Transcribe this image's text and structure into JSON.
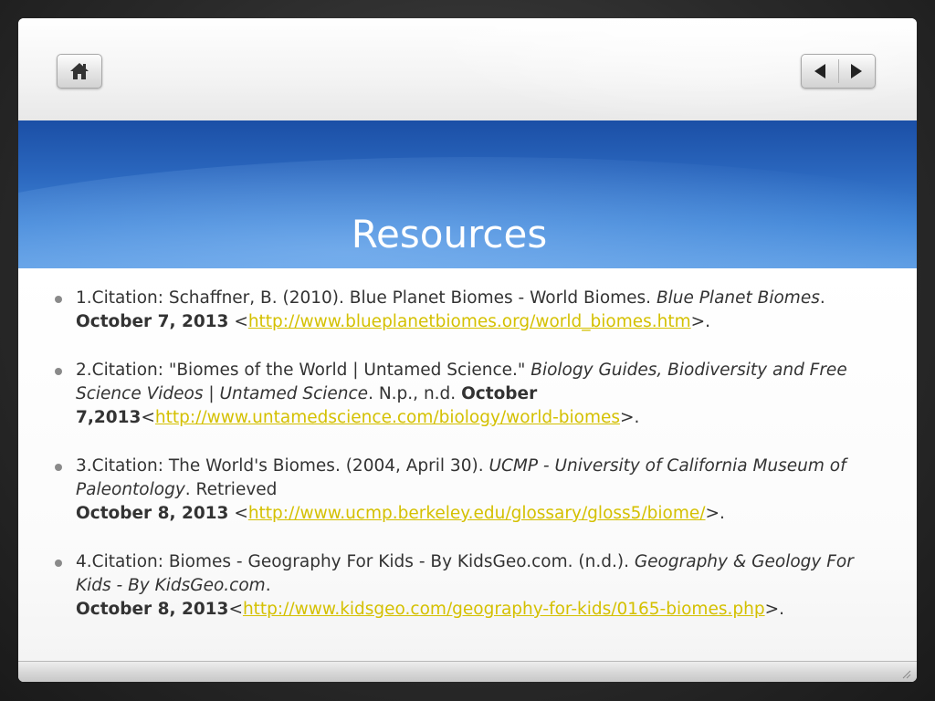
{
  "slide": {
    "title": "Resources",
    "nav": {
      "home_icon": "home-icon",
      "prev_icon": "prev-arrow-icon",
      "next_icon": "next-arrow-icon"
    }
  },
  "colors": {
    "title_band": "#2a66bd",
    "link": "#d4c000",
    "text": "#333333"
  },
  "references": [
    {
      "prefix": "1.Citation: Schaffner, B. (2010). Blue Planet Biomes - World Biomes. ",
      "italic": "Blue Planet Biomes",
      "after_italic": ". ",
      "date": "October 7, 2013",
      "before_link": " <",
      "link": "http://www.blueplanetbiomes.org/world_biomes.htm",
      "after_link": ">."
    },
    {
      "prefix": "2.Citation: \"Biomes of the World | Untamed Science.\" ",
      "italic": "Biology Guides, Biodiversity and Free Science Videos | Untamed Science",
      "after_italic": ". N.p., n.d. ",
      "date": "October 7,2013",
      "before_link": "<",
      "link": "http://www.untamedscience.com/biology/world-biomes",
      "after_link": ">."
    },
    {
      "prefix": "3.Citation: The World's Biomes. (2004, April 30). ",
      "italic": "UCMP - University of California Museum of Paleontology",
      "after_italic": ". Retrieved",
      "date": "October 8, 2013",
      "before_link": " <",
      "link": "http://www.ucmp.berkeley.edu/glossary/gloss5/biome/",
      "after_link": ">."
    },
    {
      "prefix": "4.Citation: Biomes - Geography For Kids - By KidsGeo.com. (n.d.). ",
      "italic": "Geography & Geology For Kids - By KidsGeo.com",
      "after_italic": ".",
      "date": "October 8, 2013",
      "before_link": "<",
      "link": "http://www.kidsgeo.com/geography-for-kids/0165-biomes.php",
      "after_link": ">."
    }
  ]
}
